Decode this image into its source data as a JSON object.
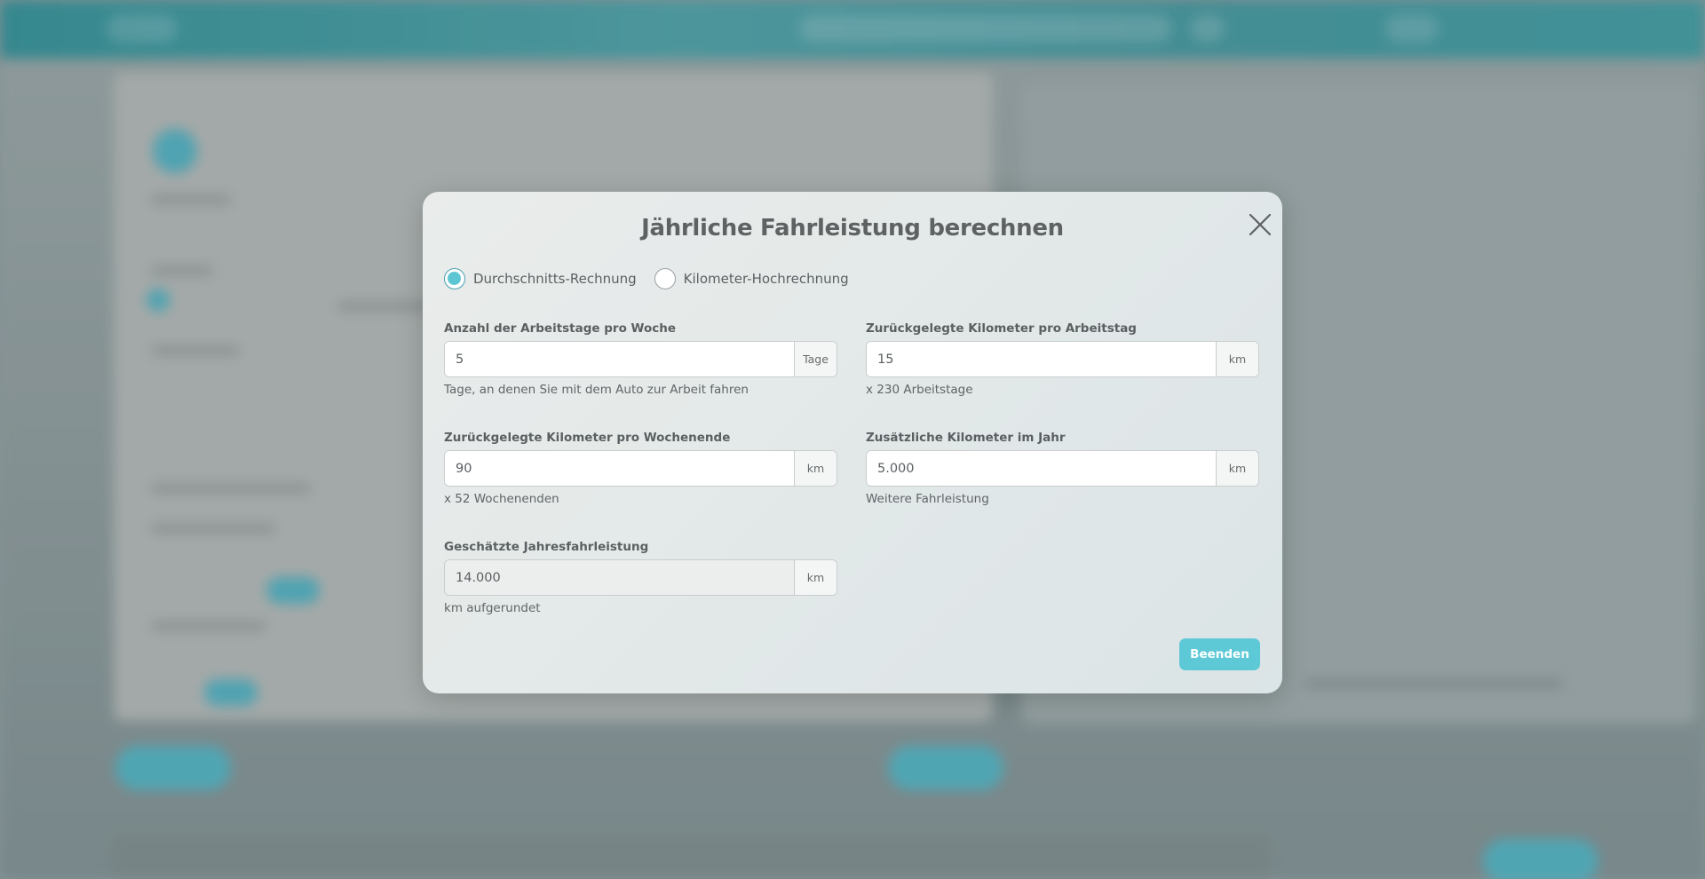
{
  "modal": {
    "title": "Jährliche Fahrleistung berechnen",
    "radio_options": [
      {
        "label": "Durchschnitts-Rechnung",
        "checked": true
      },
      {
        "label": "Kilometer-Hochrechnung",
        "checked": false
      }
    ],
    "fields": {
      "workdays": {
        "label": "Anzahl der Arbeitstage pro Woche",
        "value": "5",
        "unit": "Tage",
        "help": "Tage, an denen Sie mit dem Auto zur Arbeit fahren"
      },
      "km_per_workday": {
        "label": "Zurückgelegte Kilometer pro Arbeitstag",
        "value": "15",
        "unit": "km",
        "help": "x 230 Arbeitstage"
      },
      "km_per_weekend": {
        "label": "Zurückgelegte Kilometer pro Wochenende",
        "value": "90",
        "unit": "km",
        "help": "x 52 Wochenenden"
      },
      "extra_km": {
        "label": "Zusätzliche Kilometer im Jahr",
        "value": "5.000",
        "unit": "km",
        "help": "Weitere Fahrleistung"
      },
      "annual_estimate": {
        "label": "Geschätzte Jahresfahrleistung",
        "value": "14.000",
        "unit": "km",
        "help": "km aufgerundet"
      }
    },
    "finish_label": "Beenden"
  },
  "icons": {
    "close": "close-icon"
  },
  "colors": {
    "accent": "#5ec9d6",
    "radio_fill": "#5cc6d3",
    "title": "#5e6263",
    "topbar": "#3f959d"
  }
}
